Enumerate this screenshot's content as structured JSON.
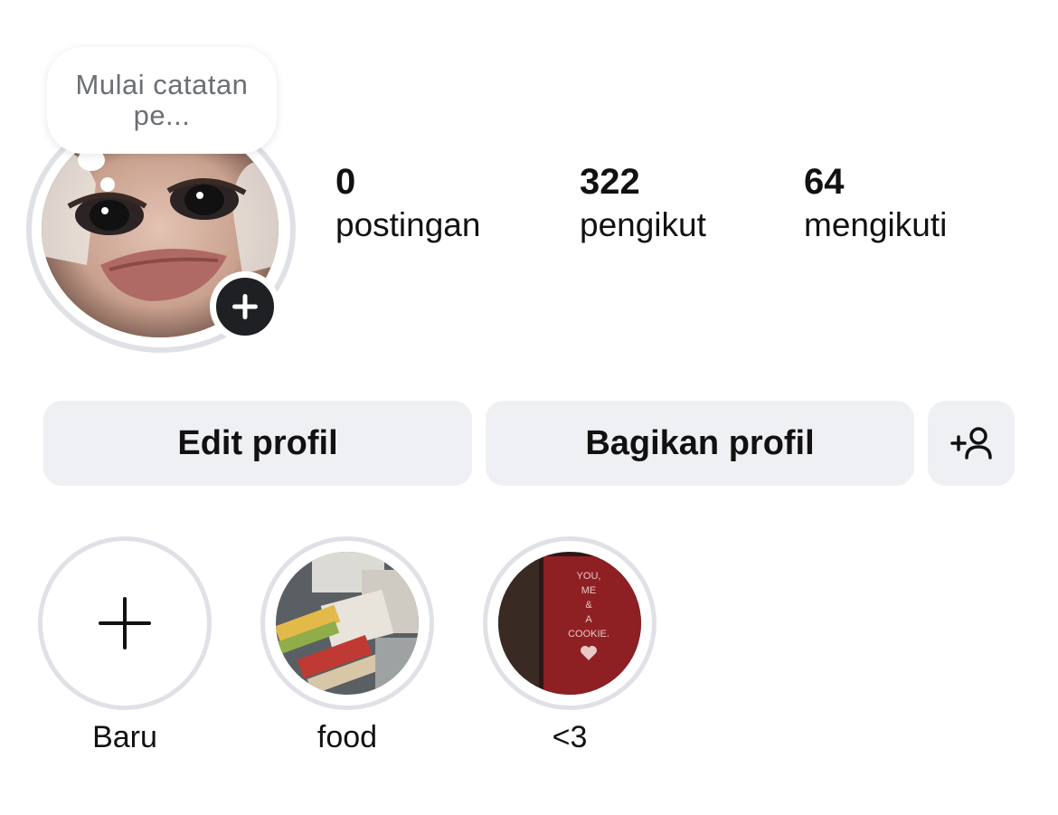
{
  "profile": {
    "note": "Mulai catatan pe...",
    "stats": [
      {
        "count": "0",
        "label": "postingan"
      },
      {
        "count": "322",
        "label": "pengikut"
      },
      {
        "count": "64",
        "label": "mengikuti"
      }
    ]
  },
  "actions": {
    "edit_label": "Edit profil",
    "share_label": "Bagikan profil",
    "add_user_icon": "person-add-icon"
  },
  "highlights": [
    {
      "label": "Baru",
      "icon": "plus-icon"
    },
    {
      "label": "food"
    },
    {
      "label": "<3",
      "thumb_text": [
        "YOU,",
        "ME",
        "&",
        "A",
        "COOKIE."
      ]
    }
  ],
  "colors": {
    "button_bg": "#eff0f3",
    "ring": "#dfe1e6",
    "badge": "#1f2023",
    "note_text": "#6c6f75"
  }
}
